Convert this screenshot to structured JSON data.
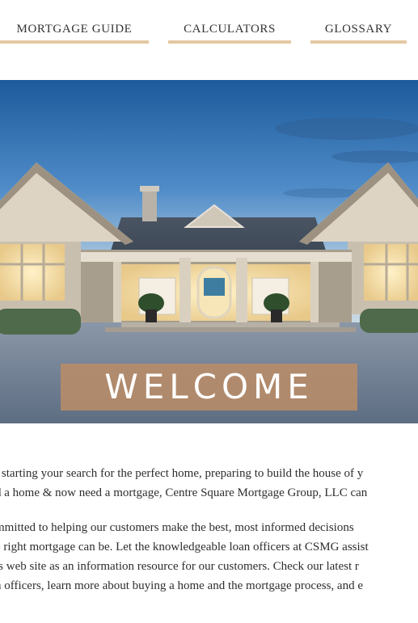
{
  "nav": {
    "items": [
      {
        "label": "MORTGAGE GUIDE"
      },
      {
        "label": "CALCULATORS"
      },
      {
        "label": "GLOSSARY"
      }
    ],
    "underline_color": "#e4c9a3"
  },
  "hero": {
    "banner_text": "WELCOME",
    "banner_color": "#ba8c68"
  },
  "content": {
    "paragraphs": [
      {
        "lines": [
          "t starting your search for the perfect home, preparing to build the house of y",
          "d a home & now need a mortgage, Centre Square Mortgage Group, LLC can"
        ]
      },
      {
        "lines": [
          "mmitted to helping our customers make the best, most informed decisions",
          "e right mortgage can be. Let the knowledgeable loan officers at CSMG assist",
          "is web site as an information resource for our customers. Check our latest r",
          "n officers, learn more about buying a home and the mortgage process, and e"
        ]
      }
    ]
  }
}
